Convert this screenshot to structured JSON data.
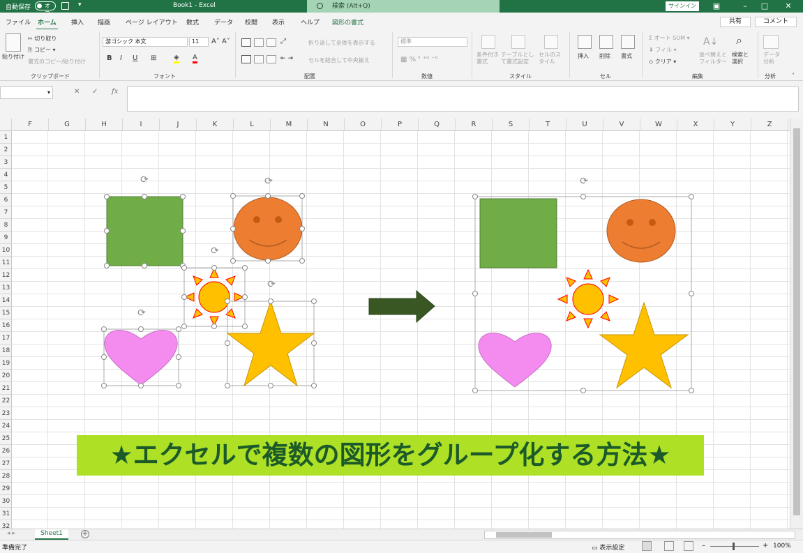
{
  "titlebar": {
    "autosave_label": "自動保存",
    "autosave_state": "オフ",
    "doc_title": "Book1  -  Excel",
    "search_placeholder": "検索 (Alt+Q)",
    "signin_label": "サインイン"
  },
  "tabs": [
    {
      "label": "ファイル"
    },
    {
      "label": "ホーム"
    },
    {
      "label": "挿入"
    },
    {
      "label": "描画"
    },
    {
      "label": "ページ レイアウト"
    },
    {
      "label": "数式"
    },
    {
      "label": "データ"
    },
    {
      "label": "校閲"
    },
    {
      "label": "表示"
    },
    {
      "label": "ヘルプ"
    },
    {
      "label": "図形の書式"
    }
  ],
  "share_label": "共有",
  "comment_label": "コメント",
  "ribbon": {
    "clipboard": {
      "paste": "貼り付け",
      "cut": "切り取り",
      "copy": "コピー",
      "format_painter": "書式のコピー/貼り付け",
      "group": "クリップボード"
    },
    "font": {
      "font_name": "游ゴシック 本文",
      "font_size": "11",
      "group": "フォント"
    },
    "alignment": {
      "wrap": "折り返して全体を表示する",
      "merge": "セルを結合して中央揃え",
      "group": "配置"
    },
    "number": {
      "format": "標準",
      "group": "数値"
    },
    "styles": {
      "conditional": "条件付き書式",
      "as_table": "テーブルとして書式設定",
      "cell_styles": "セルのスタイル",
      "group": "スタイル"
    },
    "cells": {
      "insert": "挿入",
      "delete": "削除",
      "format": "書式",
      "group": "セル"
    },
    "editing": {
      "autosum": "オート SUM",
      "fill": "フィル",
      "clear": "クリア",
      "sort_filter": "並べ替えとフィルター",
      "find_select": "検索と選択",
      "group": "編集"
    },
    "analysis": {
      "analyze_data": "データ分析",
      "group": "分析"
    }
  },
  "formula_bar": {
    "fx": "fx"
  },
  "columns": [
    "F",
    "G",
    "H",
    "I",
    "J",
    "K",
    "L",
    "M",
    "N",
    "O",
    "P",
    "Q",
    "R",
    "S",
    "T",
    "U",
    "V",
    "W",
    "X",
    "Y",
    "Z"
  ],
  "rows": [
    "1",
    "2",
    "3",
    "4",
    "5",
    "6",
    "7",
    "8",
    "9",
    "10",
    "11",
    "12",
    "13",
    "14",
    "15",
    "16",
    "17",
    "18",
    "19",
    "20",
    "21",
    "22",
    "23",
    "24",
    "25",
    "26",
    "27",
    "28",
    "29",
    "30",
    "31",
    "32"
  ],
  "banner_text": "★エクセルで複数の図形をグループ化する方法★",
  "colors": {
    "excel_green": "#217346",
    "square": "#70ad47",
    "smiley": "#ed7d31",
    "sun": "#ffc000",
    "sun_outline": "#ff0000",
    "star": "#ffc000",
    "heart": "#f48cf0",
    "arrow": "#385723",
    "banner_bg": "#aee126",
    "banner_text": "#1c5a2a"
  },
  "sheet_tab": "Sheet1",
  "status": {
    "ready": "準備完了",
    "display_settings": "表示設定",
    "zoom": "100%"
  }
}
